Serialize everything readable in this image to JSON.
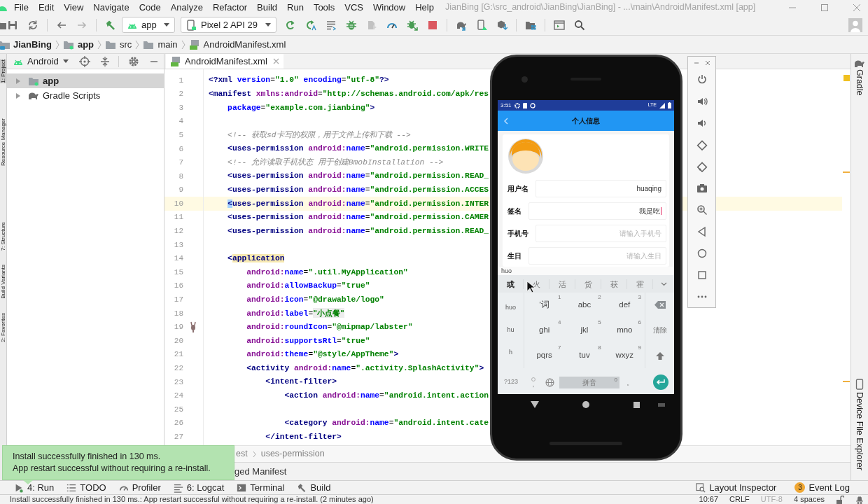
{
  "window": {
    "title": "JianBing [G:\\src_android\\JianBing\\JianBing] - ...\\main\\AndroidManifest.xml [app]"
  },
  "menu": [
    "File",
    "Edit",
    "View",
    "Navigate",
    "Code",
    "Analyze",
    "Refactor",
    "Build",
    "Run",
    "Tools",
    "VCS",
    "Window",
    "Help"
  ],
  "toolbar": {
    "run_configuration": "app",
    "device": "Pixel 2 API 29"
  },
  "breadcrumb": [
    {
      "kind": "project",
      "label": "JianBing"
    },
    {
      "kind": "module",
      "label": "app"
    },
    {
      "kind": "folder",
      "label": "src"
    },
    {
      "kind": "folder",
      "label": "main"
    },
    {
      "kind": "manifest",
      "label": "AndroidManifest.xml"
    }
  ],
  "left_strip": [
    {
      "label": "1: Project",
      "selected": true
    },
    {
      "label": "Resource Manager",
      "selected": false
    },
    {
      "label": "7: Structure",
      "selected": false
    },
    {
      "label": "Build Variants",
      "selected": false
    },
    {
      "label": "2: Favorites",
      "selected": false
    }
  ],
  "project_panel": {
    "view": "Android",
    "tree": [
      {
        "label": "app",
        "kind": "module",
        "selected": true,
        "expanded": false
      },
      {
        "label": "Gradle Scripts",
        "kind": "gradle",
        "selected": false,
        "expanded": false
      }
    ]
  },
  "editor": {
    "tabs": [
      {
        "label": "AndroidManifest.xml",
        "selected": true
      }
    ],
    "lines": [
      {
        "number": "1",
        "current": false,
        "tokens": [
          {
            "kind": "tag",
            "text": "<?xml"
          },
          {
            "kind": "attr",
            "text": " version"
          },
          {
            "kind": "plain",
            "text": "="
          },
          {
            "kind": "value",
            "text": "\"1.0\""
          },
          {
            "kind": "attr",
            "text": " encoding"
          },
          {
            "kind": "plain",
            "text": "="
          },
          {
            "kind": "value",
            "text": "\"utf-8\""
          },
          {
            "kind": "tag",
            "text": "?>"
          }
        ]
      },
      {
        "number": "2",
        "current": false,
        "tokens": [
          {
            "kind": "tag",
            "text": "<manifest"
          },
          {
            "kind": "ns",
            "text": " xmlns:android"
          },
          {
            "kind": "plain",
            "text": "="
          },
          {
            "kind": "value",
            "text": "\"http://schemas.android.com/apk/res"
          }
        ]
      },
      {
        "number": "3",
        "current": false,
        "tokens": [
          {
            "kind": "attr",
            "text": "    package"
          },
          {
            "kind": "plain",
            "text": "="
          },
          {
            "kind": "value",
            "text": "\"example.com.jianbing\""
          },
          {
            "kind": "tag",
            "text": ">"
          }
        ]
      },
      {
        "number": "4",
        "current": false
      },
      {
        "number": "5",
        "current": false,
        "tokens": [
          {
            "kind": "comment",
            "text": "    <!-- 获取sd卡写的权限，用于文件上传和下载 -->"
          }
        ]
      },
      {
        "number": "6",
        "current": false,
        "tokens": [
          {
            "kind": "tag",
            "text": "    <uses-permission"
          },
          {
            "kind": "ns",
            "text": " android:"
          },
          {
            "kind": "attr",
            "text": "name"
          },
          {
            "kind": "plain",
            "text": "="
          },
          {
            "kind": "value",
            "text": "\"android.permission.WRITE"
          }
        ]
      },
      {
        "number": "7",
        "current": false,
        "tokens": [
          {
            "kind": "comment",
            "text": "    <!-- 允许读取手机状态 用于创建BmobInstallation -->"
          }
        ]
      },
      {
        "number": "8",
        "current": false,
        "tokens": [
          {
            "kind": "tag",
            "text": "    <uses-permission"
          },
          {
            "kind": "ns",
            "text": " android:"
          },
          {
            "kind": "attr",
            "text": "name"
          },
          {
            "kind": "plain",
            "text": "="
          },
          {
            "kind": "value",
            "text": "\"android.permission.READ_"
          }
        ]
      },
      {
        "number": "9",
        "current": false,
        "tokens": [
          {
            "kind": "tag",
            "text": "    <uses-permission"
          },
          {
            "kind": "ns",
            "text": " android:"
          },
          {
            "kind": "attr",
            "text": "name"
          },
          {
            "kind": "plain",
            "text": "="
          },
          {
            "kind": "value",
            "text": "\"android.permission.ACCES"
          }
        ]
      },
      {
        "number": "10",
        "current": true,
        "tokens": [
          {
            "kind": "tag_caret",
            "text": "    <"
          },
          {
            "kind": "tag",
            "text": "uses-permission"
          },
          {
            "kind": "ns",
            "text": " android:"
          },
          {
            "kind": "attr",
            "text": "name"
          },
          {
            "kind": "plain",
            "text": "="
          },
          {
            "kind": "value",
            "text": "\"android.permission.INTER"
          }
        ]
      },
      {
        "number": "11",
        "current": false,
        "tokens": [
          {
            "kind": "tag",
            "text": "    <uses-permission"
          },
          {
            "kind": "ns",
            "text": " android:"
          },
          {
            "kind": "attr",
            "text": "name"
          },
          {
            "kind": "plain",
            "text": "="
          },
          {
            "kind": "value",
            "text": "\"android.permission.CAMER"
          }
        ]
      },
      {
        "number": "12",
        "current": false,
        "tokens": [
          {
            "kind": "tag",
            "text": "    <uses-permission"
          },
          {
            "kind": "ns",
            "text": " android:"
          },
          {
            "kind": "attr",
            "text": "name"
          },
          {
            "kind": "plain",
            "text": "="
          },
          {
            "kind": "value",
            "text": "\"android.permission.READ_"
          }
        ]
      },
      {
        "number": "13",
        "current": false
      },
      {
        "number": "14",
        "current": false,
        "tokens": [
          {
            "kind": "tag",
            "text": "    <"
          },
          {
            "kind": "tag_match",
            "text": "application"
          }
        ]
      },
      {
        "number": "15",
        "current": false,
        "tokens": [
          {
            "kind": "ns",
            "text": "        android:"
          },
          {
            "kind": "attr",
            "text": "name"
          },
          {
            "kind": "plain",
            "text": "="
          },
          {
            "kind": "value",
            "text": "\".util.MyApplication\""
          }
        ]
      },
      {
        "number": "16",
        "current": false,
        "tokens": [
          {
            "kind": "ns",
            "text": "        android:"
          },
          {
            "kind": "attr",
            "text": "allowBackup"
          },
          {
            "kind": "plain",
            "text": "="
          },
          {
            "kind": "value",
            "text": "\"true\""
          }
        ]
      },
      {
        "number": "17",
        "current": false,
        "tokens": [
          {
            "kind": "ns",
            "text": "        android:"
          },
          {
            "kind": "attr",
            "text": "icon"
          },
          {
            "kind": "plain",
            "text": "="
          },
          {
            "kind": "value",
            "text": "\"@drawable/logo\""
          }
        ]
      },
      {
        "number": "18",
        "current": false,
        "tokens": [
          {
            "kind": "ns",
            "text": "        android:"
          },
          {
            "kind": "attr",
            "text": "label"
          },
          {
            "kind": "plain",
            "text": "="
          },
          {
            "kind": "value_folded",
            "text": "\"小点餐\""
          }
        ]
      },
      {
        "number": "19",
        "current": false,
        "gutter_preview": true,
        "tokens": [
          {
            "kind": "ns",
            "text": "        android:"
          },
          {
            "kind": "attr",
            "text": "roundIcon"
          },
          {
            "kind": "plain",
            "text": "="
          },
          {
            "kind": "value",
            "text": "\"@mipmap/labster\""
          }
        ]
      },
      {
        "number": "20",
        "current": false,
        "tokens": [
          {
            "kind": "ns",
            "text": "        android:"
          },
          {
            "kind": "attr",
            "text": "supportsRtl"
          },
          {
            "kind": "plain",
            "text": "="
          },
          {
            "kind": "value",
            "text": "\"true\""
          }
        ]
      },
      {
        "number": "21",
        "current": false,
        "tokens": [
          {
            "kind": "ns",
            "text": "        android:"
          },
          {
            "kind": "attr",
            "text": "theme"
          },
          {
            "kind": "plain",
            "text": "="
          },
          {
            "kind": "value",
            "text": "\"@style/AppTheme\""
          },
          {
            "kind": "tag",
            "text": ">"
          }
        ]
      },
      {
        "number": "22",
        "current": false,
        "tokens": [
          {
            "kind": "tag",
            "text": "        <activity"
          },
          {
            "kind": "ns",
            "text": " android:"
          },
          {
            "kind": "attr",
            "text": "name"
          },
          {
            "kind": "plain",
            "text": "="
          },
          {
            "kind": "value",
            "text": "\".activity.SplashActivity\""
          },
          {
            "kind": "tag",
            "text": ">"
          }
        ]
      },
      {
        "number": "23",
        "current": false,
        "tokens": [
          {
            "kind": "tag",
            "text": "            <intent-filter>"
          }
        ]
      },
      {
        "number": "24",
        "current": false,
        "tokens": [
          {
            "kind": "tag",
            "text": "                <action"
          },
          {
            "kind": "ns",
            "text": " android:"
          },
          {
            "kind": "attr",
            "text": "name"
          },
          {
            "kind": "plain",
            "text": "="
          },
          {
            "kind": "value",
            "text": "\"android.intent.action"
          }
        ]
      },
      {
        "number": "25",
        "current": false
      },
      {
        "number": "26",
        "current": false,
        "tokens": [
          {
            "kind": "tag",
            "text": "                <category"
          },
          {
            "kind": "ns",
            "text": " android:"
          },
          {
            "kind": "attr",
            "text": "name"
          },
          {
            "kind": "plain",
            "text": "="
          },
          {
            "kind": "value",
            "text": "\"android.intent.cate"
          }
        ]
      },
      {
        "number": "27",
        "current": false,
        "tokens": [
          {
            "kind": "tag",
            "text": "            </intent-filter>"
          }
        ]
      }
    ],
    "path": [
      "est",
      "uses-permission"
    ],
    "bottom_tabs": [
      "ged Manifest"
    ]
  },
  "right_strip": [
    "Gradle",
    "Device File Explorer"
  ],
  "emulator": {
    "status_time": "3:51",
    "network": "LTE",
    "title": "个人信息",
    "fields": [
      {
        "label": "用户名",
        "value": "huaqing",
        "focused": false
      },
      {
        "label": "签名",
        "value": "我是吃",
        "focused": true
      },
      {
        "label": "手机号",
        "placeholder": "请输入手机号",
        "focused": false
      },
      {
        "label": "生日",
        "placeholder": "请输入生日",
        "focused": false
      }
    ],
    "keyboard": {
      "composition": "huo",
      "candidates": [
        {
          "text": "或",
          "selected": true
        },
        {
          "text": "火",
          "selected": false
        },
        {
          "text": "活",
          "selected": false
        },
        {
          "text": "货",
          "selected": false
        },
        {
          "text": "获",
          "selected": false
        },
        {
          "text": "霍",
          "selected": false
        }
      ],
      "pinyin": [
        "huo",
        "hu",
        "h"
      ],
      "keys": [
        {
          "label": "'词",
          "number": "1"
        },
        {
          "label": "abc",
          "number": "2"
        },
        {
          "label": "def",
          "number": "3"
        },
        {
          "label": "ghi",
          "number": "4"
        },
        {
          "label": "jkl",
          "number": "5"
        },
        {
          "label": "mno",
          "number": "6"
        },
        {
          "label": "pqrs",
          "number": "7"
        },
        {
          "label": "tuv",
          "number": "8"
        },
        {
          "label": "wxyz",
          "number": "9"
        }
      ],
      "clear": "清除",
      "symbols": "?123",
      "comma": ",",
      "space": "拼音",
      "space_number": "0",
      "period": "。"
    }
  },
  "notification": [
    "Install successfully finished in 130 ms.",
    "App restart successful without requiring a re-install."
  ],
  "tool_windows": {
    "left": [
      {
        "kind": "run",
        "label": "4: Run"
      },
      {
        "kind": "todo",
        "label": "TODO"
      },
      {
        "kind": "profiler",
        "label": "Profiler"
      },
      {
        "kind": "logcat",
        "label": "6: Logcat"
      },
      {
        "kind": "terminal",
        "label": "Terminal"
      },
      {
        "kind": "build",
        "label": "Build"
      }
    ],
    "right": [
      {
        "kind": "inspector",
        "label": "Layout Inspector"
      },
      {
        "kind": "eventlog",
        "label": "Event Log",
        "badge": "3"
      }
    ]
  },
  "status_bar": {
    "message": "Install successfully finished in 130 ms.: App restart successful without requiring a re-install. (2 minutes ago)",
    "position": "10:67",
    "line_separator": "CRLF",
    "encoding": "UTF-8",
    "indent": "4 spaces"
  }
}
